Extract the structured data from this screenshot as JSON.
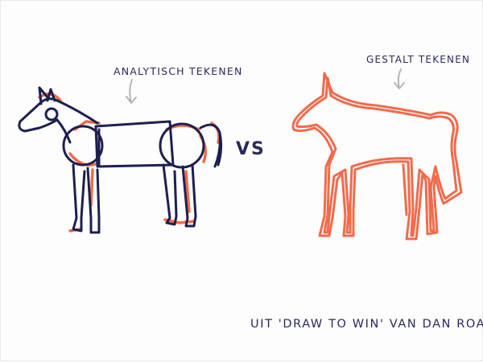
{
  "labels": {
    "analytic": "ANALYTISCH TEKENEN",
    "gestalt": "GESTALT TEKENEN",
    "vs": "VS",
    "credit": "UIT 'DRAW TO WIN' VAN DAN ROAM"
  },
  "colors": {
    "ink": "#1e1f4f",
    "accent": "#f26a4b",
    "arrow": "#b5b5b5",
    "background": "#fdfdfd"
  }
}
